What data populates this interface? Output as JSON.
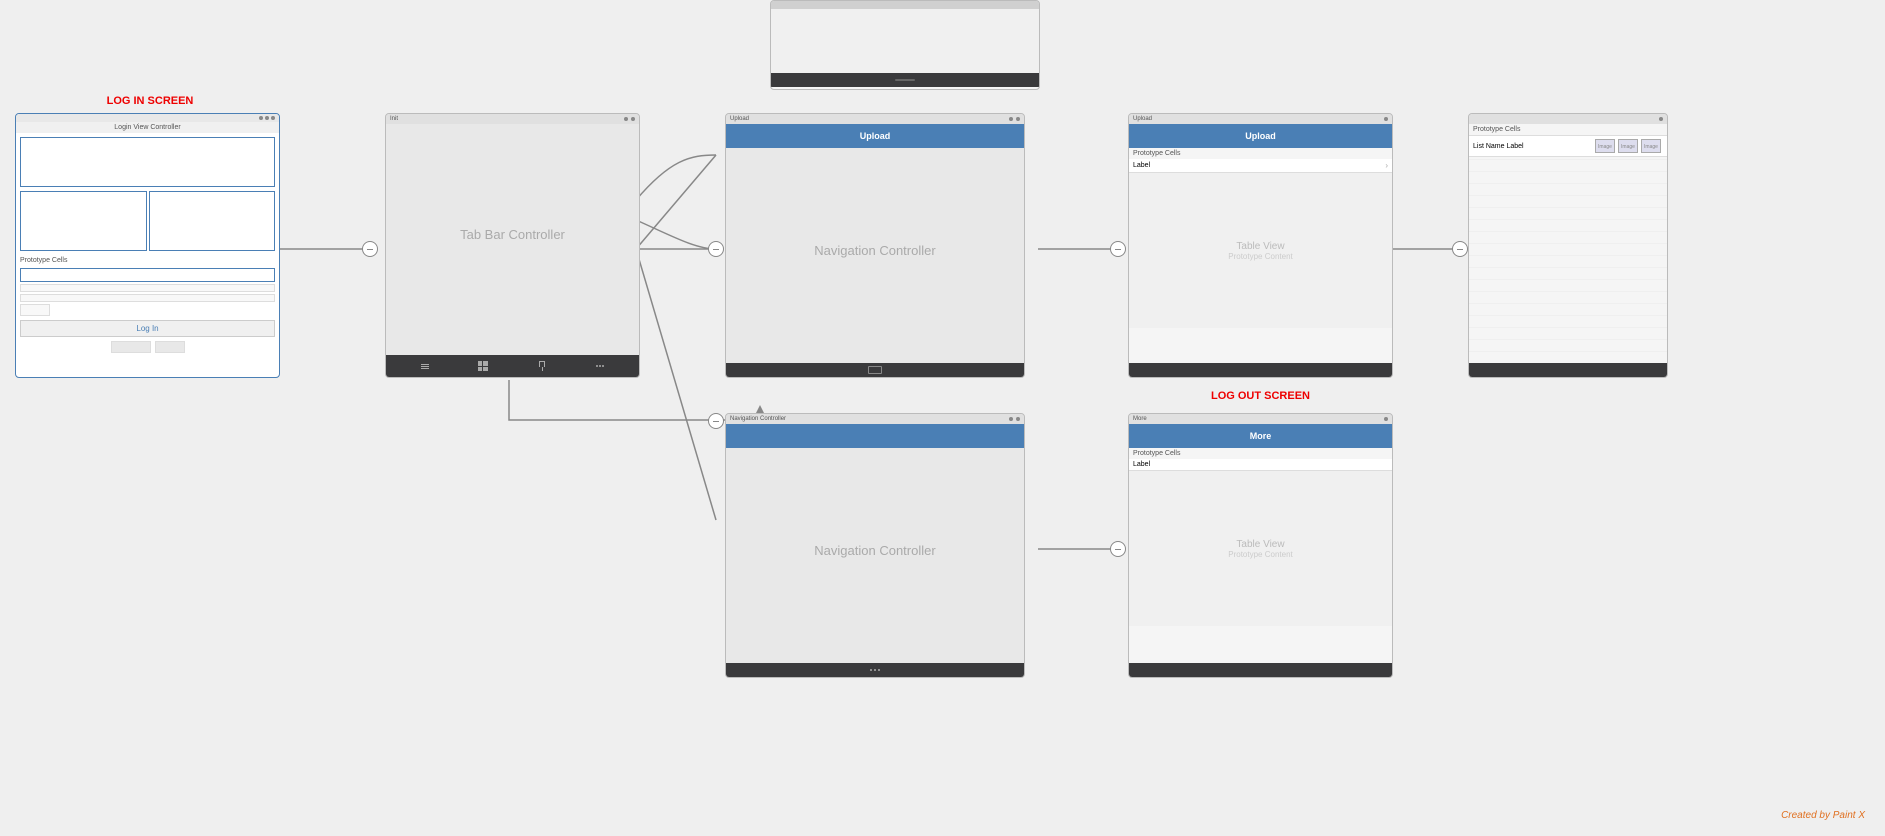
{
  "canvas": {
    "background": "#efefef"
  },
  "screens": {
    "login_label": "LOG IN SCREEN",
    "logout_label": "LOG OUT SCREEN",
    "watermark": "Created by Paint X"
  },
  "frames": {
    "login": {
      "title": "Login View Controller",
      "prototype_cells": "Prototype Cells",
      "login_button": "Log In"
    },
    "tab_bar": {
      "label": "Tab Bar Controller",
      "title": "Init"
    },
    "nav1": {
      "label": "Navigation Controller",
      "title": "Upload",
      "nav_title": "Upload"
    },
    "nav2": {
      "label": "Navigation Controller"
    },
    "table1": {
      "title": "Upload",
      "nav_title": "Upload",
      "prototype_cells": "Prototype Cells",
      "cell_label": "Label",
      "table_view": "Table View",
      "prototype_content": "Prototype Content"
    },
    "table2": {
      "prototype_cells": "Prototype Cells",
      "list_name_label": "List Name Label",
      "image1": "Image",
      "image2": "Image",
      "image3": "Image"
    },
    "more_table": {
      "title": "More",
      "nav_title": "More",
      "prototype_cells": "Prototype Cells",
      "cell_label": "Label",
      "table_view": "Table View",
      "prototype_content": "Prototype Content"
    }
  }
}
